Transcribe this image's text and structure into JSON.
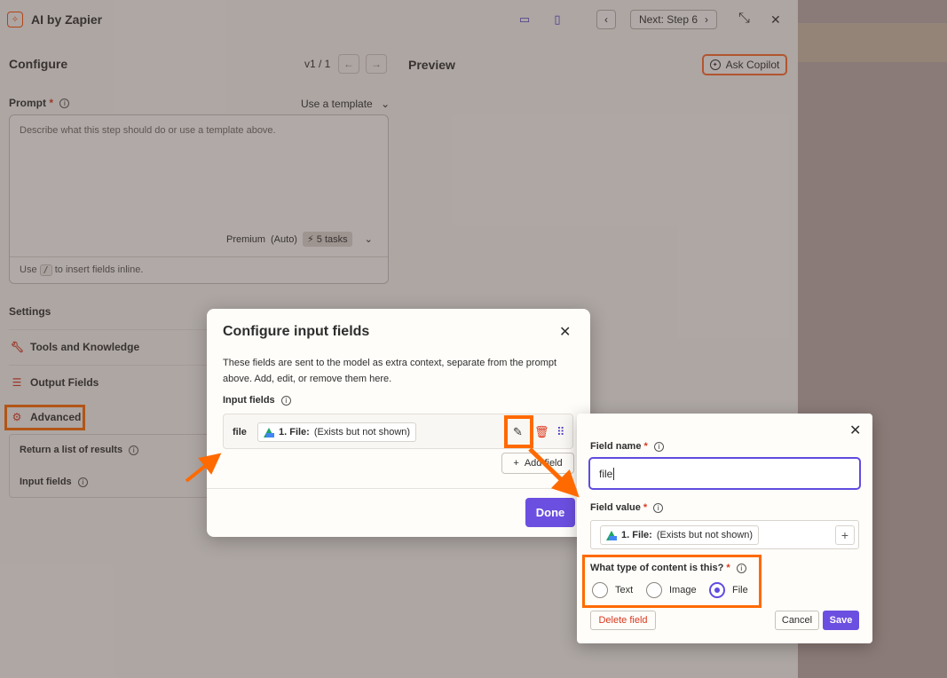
{
  "app": {
    "title": "AI by Zapier",
    "next_step_label": "Next: Step 6",
    "close_glyph": "✕",
    "collapse_glyph": "⤡"
  },
  "configure": {
    "title": "Configure",
    "version": "v1 / 1",
    "preview_title": "Preview",
    "copilot_label": "Ask Copilot"
  },
  "prompt": {
    "label": "Prompt",
    "required_mark": "*",
    "template_link": "Use a template",
    "placeholder": "Describe what this step should do or use a template above.",
    "model_label": "Premium",
    "model_mode": "(Auto)",
    "tasks": "5 tasks",
    "hint_prefix": "Use",
    "hint_key": "/",
    "hint_suffix": "to insert fields inline."
  },
  "settings": {
    "title": "Settings",
    "items": [
      {
        "label": "Tools and Knowledge"
      },
      {
        "label": "Output Fields"
      },
      {
        "label": "Advanced"
      }
    ],
    "advanced_rows": [
      "Return a list of results",
      "Input fields"
    ]
  },
  "modal": {
    "title": "Configure input fields",
    "description": "These fields are sent to the model as extra context, separate from the prompt above. Add, edit, or remove them here.",
    "inputs_label": "Input fields",
    "field": {
      "name": "file",
      "chip_ref": "1. File:",
      "chip_note": "(Exists but not shown)"
    },
    "add_field_label": "Add field",
    "done_label": "Done"
  },
  "editor": {
    "field_name_label": "Field name",
    "field_name_value": "file",
    "field_value_label": "Field value",
    "chip_ref": "1. File:",
    "chip_note": "(Exists but not shown)",
    "content_type_label": "What type of content is this?",
    "options": [
      "Text",
      "Image",
      "File"
    ],
    "selected": "File",
    "delete_label": "Delete field",
    "cancel_label": "Cancel",
    "save_label": "Save"
  },
  "colors": {
    "accent": "#6b4fe0",
    "highlight": "#ff6a00",
    "danger": "#d9381e"
  }
}
